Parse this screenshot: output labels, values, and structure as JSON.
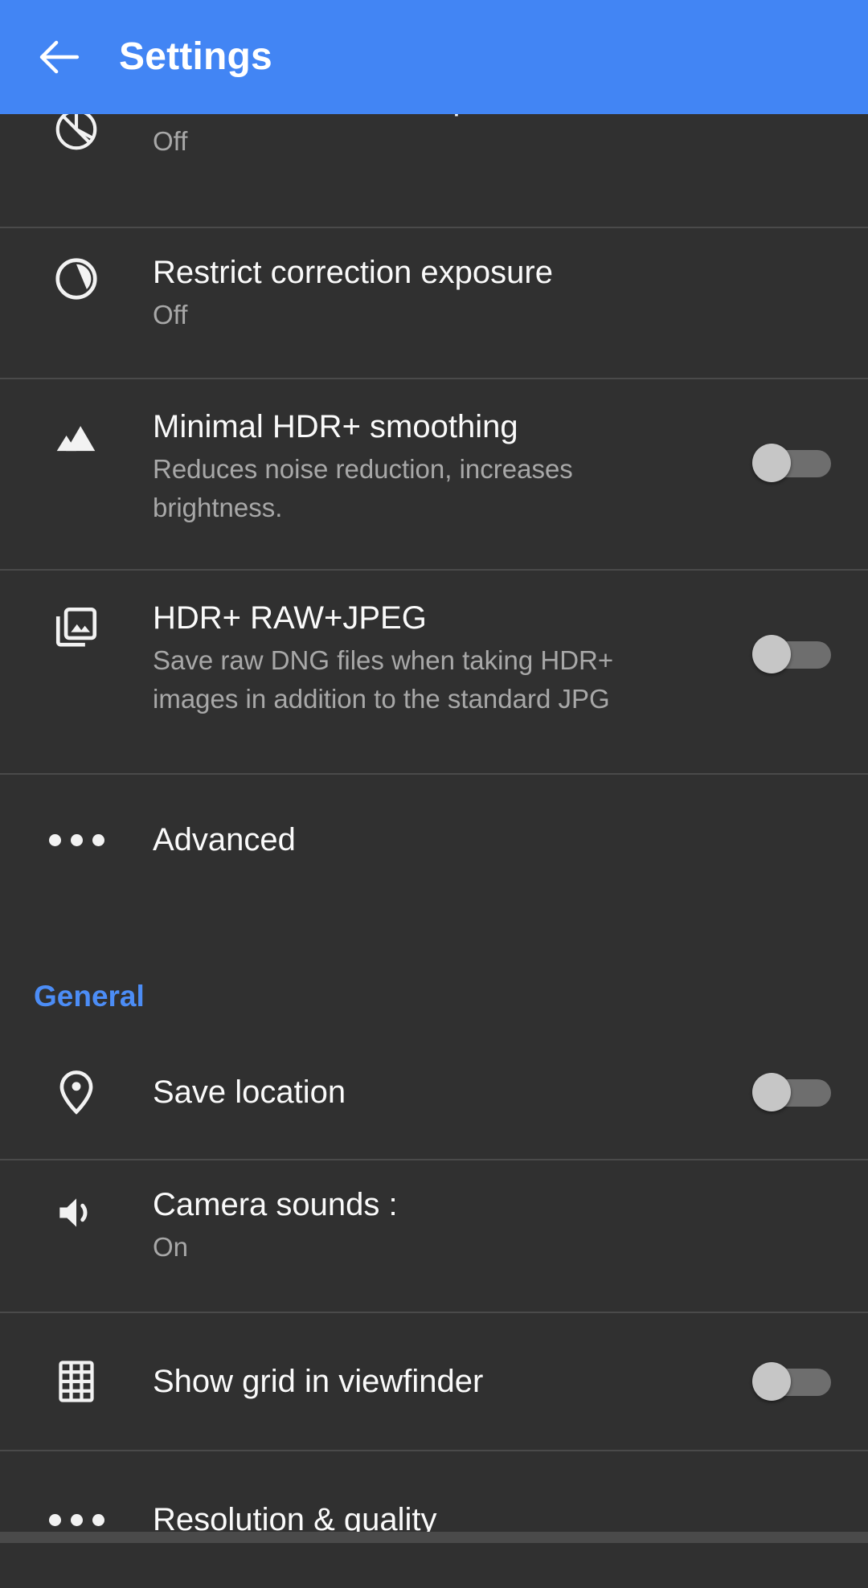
{
  "appbar": {
    "back_icon": "arrow-left-icon",
    "title": "Settings",
    "background_color": "#4285F4",
    "title_color": "#FFFFFF"
  },
  "theme": {
    "page_background": "#2E2E2E",
    "row_background": "#303030",
    "divider_color": "#4A4A4A",
    "title_color": "#FAFAFA",
    "subtitle_color": "#A8A8A8",
    "accent_color": "#4C8DF6",
    "switch_track_off": "#6E6E6E",
    "switch_thumb_off": "#C6C6C6"
  },
  "rows": [
    {
      "id": "correction-auto-exposure-hdr",
      "icon": "exposure-circle-icon",
      "title": "Correction of auto-exposure HDR+",
      "subtitle": "Off",
      "control": "none",
      "clipped": true
    },
    {
      "id": "restrict-correction-exposure",
      "icon": "exposure-pie-icon",
      "title": "Restrict correction exposure",
      "subtitle": "Off",
      "control": "none"
    },
    {
      "id": "minimal-hdr-smoothing",
      "icon": "landscape-mountains-icon",
      "title": "Minimal HDR+ smoothing",
      "subtitle": "Reduces noise reduction, increases brightness.",
      "control": "switch",
      "switch_state": "off"
    },
    {
      "id": "hdr-raw-jpeg",
      "icon": "photo-library-icon",
      "title": "HDR+ RAW+JPEG",
      "subtitle": "Save raw DNG files when taking HDR+ images in addition to the standard JPG",
      "control": "switch",
      "switch_state": "off"
    },
    {
      "id": "advanced",
      "icon": "more-horizontal-icon",
      "title": "Advanced",
      "subtitle": "",
      "control": "none"
    }
  ],
  "section_general": {
    "label": "General",
    "rows": [
      {
        "id": "save-location",
        "icon": "location-pin-icon",
        "title": "Save location",
        "subtitle": "",
        "control": "switch",
        "switch_state": "off"
      },
      {
        "id": "camera-sounds",
        "icon": "volume-up-icon",
        "title": "Camera sounds :",
        "subtitle": "On",
        "control": "none"
      },
      {
        "id": "show-grid-viewfinder",
        "icon": "grid-icon",
        "title": "Show grid in viewfinder",
        "subtitle": "",
        "control": "switch",
        "switch_state": "off"
      },
      {
        "id": "resolution-quality",
        "icon": "more-horizontal-icon",
        "title": "Resolution & quality",
        "subtitle": "",
        "control": "none"
      }
    ]
  }
}
